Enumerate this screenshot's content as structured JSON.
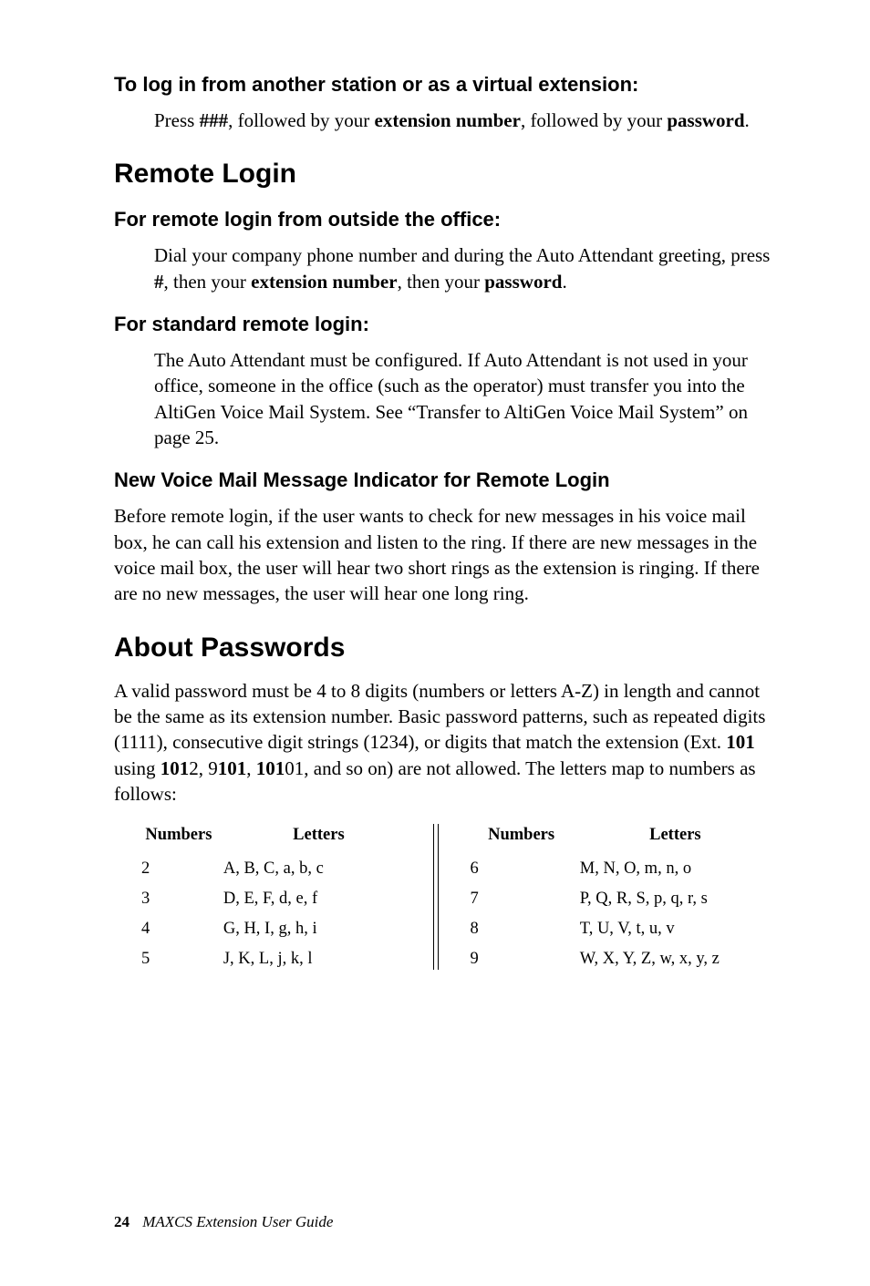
{
  "section1": {
    "heading": "To log in from another station or as a virtual extension:",
    "para_parts": {
      "p1": "Press ",
      "p2": "###",
      "p3": ", followed by your ",
      "p4": "extension number",
      "p5": ", followed by your ",
      "p6": "password",
      "p7": "."
    }
  },
  "section2": {
    "heading": "Remote Login",
    "sub1_heading": "For remote login from outside the office:",
    "sub1_para": {
      "p1": "Dial your company phone number and during the Auto Attendant greeting, press ",
      "p2": "#",
      "p3": ", then your ",
      "p4": "extension number",
      "p5": ", then your ",
      "p6": "password",
      "p7": "."
    },
    "sub2_heading": "For standard remote login:",
    "sub2_para": "The Auto Attendant must be configured. If Auto Attendant is not used in your office, someone in the office (such as the operator) must transfer you into the AltiGen Voice Mail System. See “Transfer to AltiGen Voice Mail System” on page 25.",
    "sub3_heading": "New Voice Mail Message Indicator for Remote Login",
    "sub3_para": "Before remote login, if the user wants to check for new messages in his voice mail box, he can call his extension and listen to the ring. If there are new messages in the voice mail box, the user will hear two short rings as the extension is ringing. If there are no new messages, the user will hear one long ring."
  },
  "section3": {
    "heading": "About Passwords",
    "para": {
      "p1": "A valid password must be 4 to 8 digits (numbers or letters A-Z) in length and cannot be the same as its extension number. Basic password patterns, such as repeated digits (1111), consecutive digit strings (1234), or digits that match the extension (Ext. ",
      "p2": "101",
      "p3": " using ",
      "p4": "101",
      "p5": "2, 9",
      "p6": "101",
      "p7": ", ",
      "p8": "101",
      "p9": "01, and so on) are not allowed. The letters map to numbers as follows:"
    }
  },
  "table": {
    "headers": {
      "num_left": "Numbers",
      "let_left": "Letters",
      "num_right": "Numbers",
      "let_right": "Letters"
    },
    "rows": [
      {
        "nl": "2",
        "ll": "A, B, C, a, b, c",
        "nr": "6",
        "lr": "M, N, O, m, n, o"
      },
      {
        "nl": "3",
        "ll": "D, E, F, d, e, f",
        "nr": "7",
        "lr": "P, Q, R, S, p, q, r, s"
      },
      {
        "nl": "4",
        "ll": "G, H, I, g, h, i",
        "nr": "8",
        "lr": "T, U, V, t, u, v"
      },
      {
        "nl": "5",
        "ll": "J, K, L, j, k, l",
        "nr": "9",
        "lr": "W, X, Y, Z, w, x, y, z"
      }
    ]
  },
  "footer": {
    "page_number": "24",
    "title": "MAXCS Extension User Guide"
  }
}
